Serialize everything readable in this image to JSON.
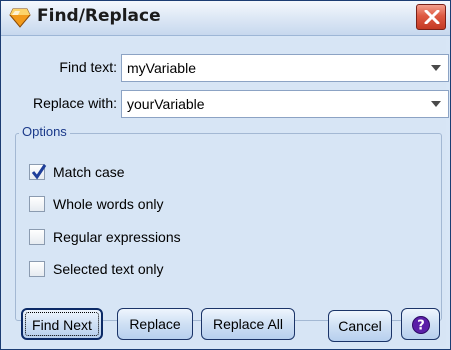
{
  "window": {
    "title": "Find/Replace"
  },
  "find": {
    "label": "Find text:",
    "value": "myVariable"
  },
  "replace": {
    "label": "Replace with:",
    "value": "yourVariable"
  },
  "options": {
    "legend": "Options",
    "items": [
      {
        "label": "Match case",
        "checked": true
      },
      {
        "label": "Whole words only",
        "checked": false
      },
      {
        "label": "Regular expressions",
        "checked": false
      },
      {
        "label": "Selected text only",
        "checked": false
      }
    ]
  },
  "buttons": {
    "find_next": "Find Next",
    "replace": "Replace",
    "replace_all": "Replace All",
    "cancel": "Cancel",
    "help_icon": "help-icon"
  },
  "colors": {
    "title_bg": "#dfe9f6",
    "body_bg": "#d7e5f5",
    "close_red": "#de5a43",
    "help_purple": "#5b1fa8"
  }
}
